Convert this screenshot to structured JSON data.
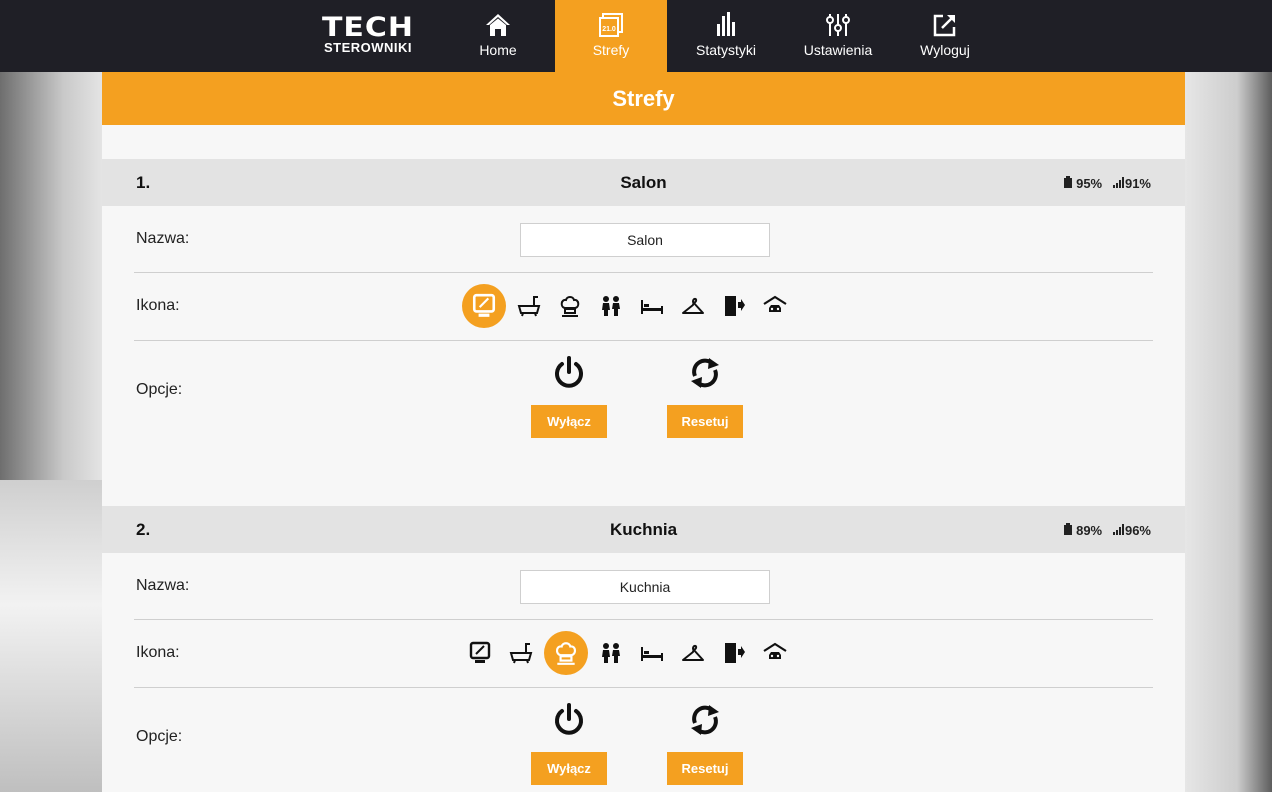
{
  "app": {
    "logo_main": "TECH",
    "logo_sub": "STEROWNIKI"
  },
  "nav": [
    {
      "label": "Home",
      "icon": "home-icon",
      "active": false
    },
    {
      "label": "Strefy",
      "icon": "zones-icon",
      "active": true,
      "icon_text": "21.0"
    },
    {
      "label": "Statystyki",
      "icon": "statistics-icon",
      "active": false
    },
    {
      "label": "Ustawienia",
      "icon": "settings-sliders-icon",
      "active": false
    },
    {
      "label": "Wyloguj",
      "icon": "logout-icon",
      "active": false
    }
  ],
  "page": {
    "title": "Strefy"
  },
  "colors": {
    "accent": "#f4a020",
    "topbar": "#1f1f26",
    "zone_header": "#e3e3e3"
  },
  "zones": [
    {
      "number": "1.",
      "title": "Salon",
      "battery": "95%",
      "signal": "91%",
      "name_label": "Nazwa:",
      "name_value": "Salon",
      "icon_label": "Ikona:",
      "selected_icon": "monitor-icon",
      "options_label": "Opcje:",
      "off_button": "Wyłącz",
      "reset_button": "Resetuj"
    },
    {
      "number": "2.",
      "title": "Kuchnia",
      "battery": "89%",
      "signal": "96%",
      "name_label": "Nazwa:",
      "name_value": "Kuchnia",
      "icon_label": "Ikona:",
      "selected_icon": "chef-hat-icon",
      "options_label": "Opcje:",
      "off_button": "Wyłącz",
      "reset_button": "Resetuj"
    }
  ],
  "zone_icons": [
    "monitor-icon",
    "bathtub-icon",
    "chef-hat-icon",
    "children-icon",
    "bed-icon",
    "hanger-icon",
    "door-exit-icon",
    "garage-car-icon"
  ]
}
